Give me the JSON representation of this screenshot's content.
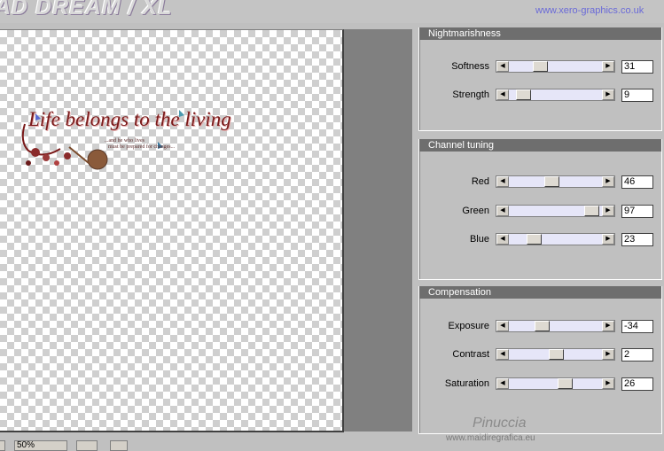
{
  "header": {
    "title": "AD DREAM / XL",
    "url": "www.xero-graphics.co.uk"
  },
  "preview": {
    "artwork_text": "Life belongs to the living",
    "artwork_sub1": "...and he who lives",
    "artwork_sub2": "must be prepared for changes..."
  },
  "bottom_bar": {
    "zoom": "50%"
  },
  "panels": [
    {
      "title": "Nightmarishness",
      "sliders": [
        {
          "label": "Softness",
          "value": "31",
          "fraction": 0.31
        },
        {
          "label": "Strength",
          "value": "9",
          "fraction": 0.09
        }
      ]
    },
    {
      "title": "Channel tuning",
      "sliders": [
        {
          "label": "Red",
          "value": "46",
          "fraction": 0.46
        },
        {
          "label": "Green",
          "value": "97",
          "fraction": 0.97
        },
        {
          "label": "Blue",
          "value": "23",
          "fraction": 0.23
        }
      ]
    },
    {
      "title": "Compensation",
      "sliders": [
        {
          "label": "Exposure",
          "value": "-34",
          "fraction": 0.33
        },
        {
          "label": "Contrast",
          "value": "2",
          "fraction": 0.51
        },
        {
          "label": "Saturation",
          "value": "26",
          "fraction": 0.63
        }
      ]
    }
  ],
  "watermark": {
    "name": "Pinuccia",
    "site": "www.maidiregrafica.eu"
  }
}
